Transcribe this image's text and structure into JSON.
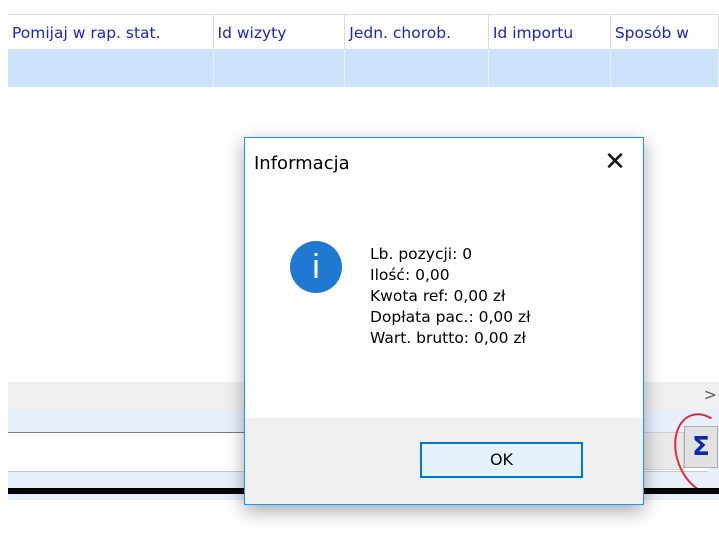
{
  "grid": {
    "columns": [
      {
        "label": "Pomijaj w rap. stat."
      },
      {
        "label": "Id wizyty"
      },
      {
        "label": "Jedn. chorob."
      },
      {
        "label": "Id importu"
      },
      {
        "label": "Sposób w"
      }
    ]
  },
  "scrollbar": {
    "right_glyph": ">"
  },
  "toolbar": {
    "sum_label": "Σ"
  },
  "dialog": {
    "title": "Informacja",
    "close_glyph": "✕",
    "icon_glyph": "i",
    "lines": [
      "Lb. pozycji: 0",
      "Ilość: 0,00",
      "Kwota ref: 0,00 zł",
      "Dopłata pac.: 0,00 zł",
      "Wart. brutto: 0,00 zł"
    ],
    "ok_label": "OK"
  },
  "colors": {
    "header_text": "#1a24c8",
    "selected_row": "#cce3fb",
    "dialog_border": "#1e90ff",
    "annotation": "#e3283a"
  }
}
